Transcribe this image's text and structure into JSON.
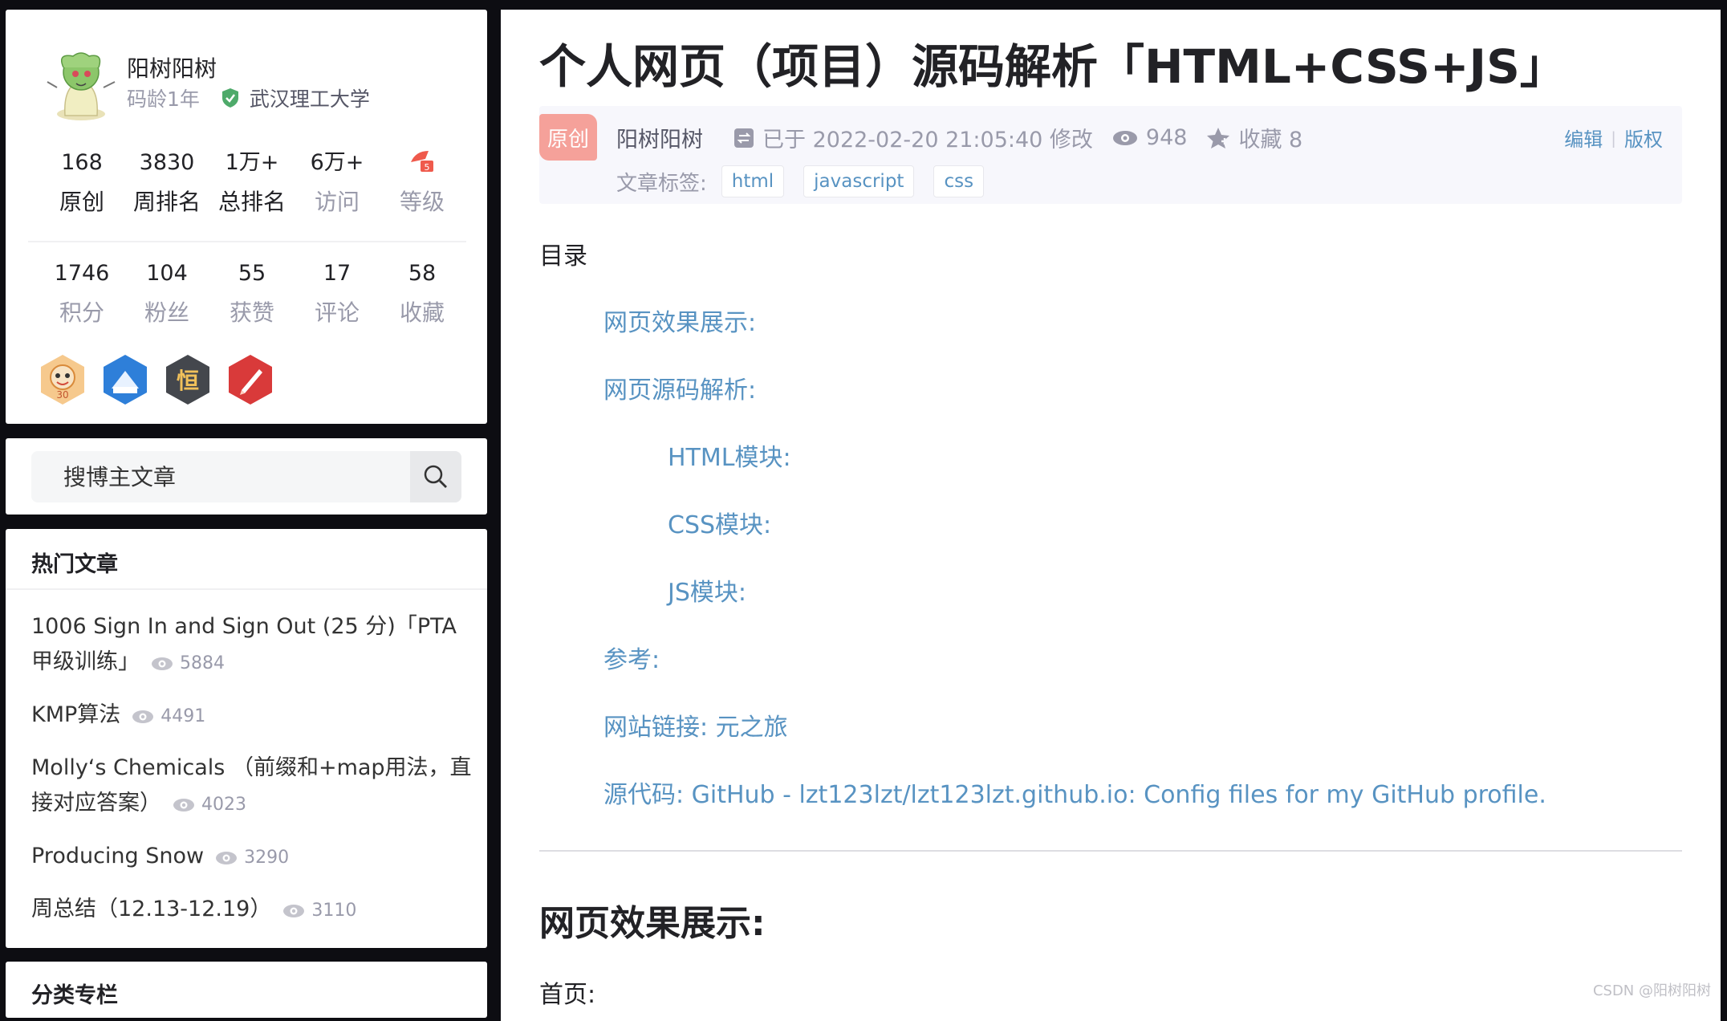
{
  "profile": {
    "name": "阳树阳树",
    "years": "码龄1年",
    "school": "武汉理工大学",
    "stats_row1": [
      {
        "value": "168",
        "label": "原创"
      },
      {
        "value": "3830",
        "label": "周排名"
      },
      {
        "value": "1万+",
        "label": "总排名"
      },
      {
        "value": "6万+",
        "label": "访问"
      },
      {
        "value": "",
        "label": "等级"
      }
    ],
    "stats_row2": [
      {
        "value": "1746",
        "label": "积分"
      },
      {
        "value": "104",
        "label": "粉丝"
      },
      {
        "value": "55",
        "label": "获赞"
      },
      {
        "value": "17",
        "label": "评论"
      },
      {
        "value": "58",
        "label": "收藏"
      }
    ],
    "badges": [
      "monkey-badge-icon",
      "blog-badge-icon",
      "persistence-badge-icon",
      "pen-badge-icon"
    ],
    "badge_texts": [
      "30",
      "恒"
    ]
  },
  "search": {
    "placeholder": "搜博主文章"
  },
  "hot": {
    "title": "热门文章",
    "items": [
      {
        "title": "1006 Sign In and Sign Out (25 分)「PTA甲级训练」",
        "views": "5884"
      },
      {
        "title": "KMP算法",
        "views": "4491"
      },
      {
        "title": "Molly‘s Chemicals （前缀和+map用法，直接对应答案）",
        "views": "4023"
      },
      {
        "title": "Producing Snow",
        "views": "3290"
      },
      {
        "title": "周总结（12.13-12.19）",
        "views": "3110"
      }
    ]
  },
  "category": {
    "title": "分类专栏"
  },
  "article": {
    "title": "个人网页（项目）源码解析「HTML+CSS+JS」",
    "orig_tag": "原创",
    "author": "阳树阳树",
    "modified": "已于 2022-02-20 21:05:40 修改",
    "views": "948",
    "favorites": "收藏 8",
    "edit": "编辑",
    "copyright": "版权",
    "tags_label": "文章标签:",
    "tags": [
      "html",
      "javascript",
      "css"
    ],
    "toc_title": "目录",
    "toc": [
      "网页效果展示:",
      "网页源码解析:",
      "HTML模块:",
      "CSS模块:",
      "JS模块:",
      "参考:",
      "网站链接: 元之旅",
      "源代码: GitHub - lzt123lzt/lzt123lzt.github.io: Config files for my GitHub profile."
    ],
    "h2": "网页效果展示:",
    "para": "首页:"
  },
  "watermark": "CSDN @阳树阳树",
  "colors": {
    "link": "#5893c2",
    "orig_tag": "#f5a19a",
    "background": "#0d0d12"
  }
}
